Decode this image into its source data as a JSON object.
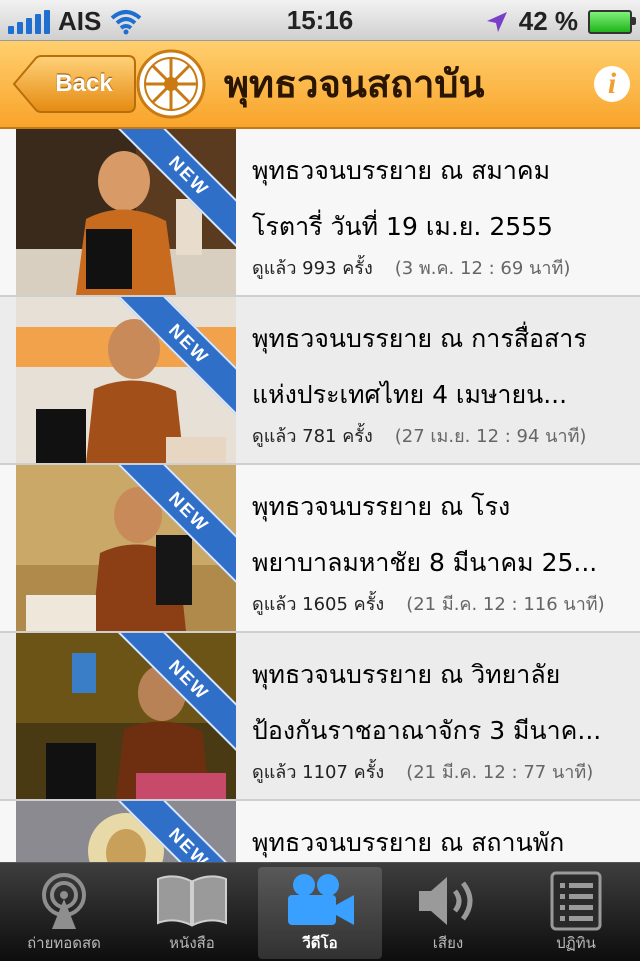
{
  "status": {
    "carrier": "AIS",
    "time": "15:16",
    "battery": "42 %"
  },
  "nav": {
    "back_label": "Back",
    "title": "พุทธวจนสถาบัน"
  },
  "videos": [
    {
      "line1": "พุทธวจนบรรยาย ณ สมาคม",
      "line2": "โรตารี่ วันที่ 19 เม.ย. 2555",
      "views": "ดูแล้ว 993 ครั้ง",
      "info": "(3 พ.ค. 12 : 69 นาที)",
      "badge": "NEW"
    },
    {
      "line1": "พุทธวจนบรรยาย ณ การสื่อสาร",
      "line2": "แห่งประเทศไทย 4 เมษายน...",
      "views": "ดูแล้ว 781 ครั้ง",
      "info": "(27 เม.ย. 12 : 94 นาที)",
      "badge": "NEW"
    },
    {
      "line1": "พุทธวจนบรรยาย ณ โรง",
      "line2": "พยาบาลมหาชัย 8 มีนาคม 25...",
      "views": "ดูแล้ว 1605 ครั้ง",
      "info": "(21 มี.ค. 12 : 116 นาที)",
      "badge": "NEW"
    },
    {
      "line1": "พุทธวจนบรรยาย ณ วิทยาลัย",
      "line2": "ป้องกันราชอาณาจักร 3 มีนาค...",
      "views": "ดูแล้ว 1107 ครั้ง",
      "info": "(21 มี.ค. 12 : 77 นาที)",
      "badge": "NEW"
    },
    {
      "line1": "พุทธวจนบรรยาย ณ สถานพัก",
      "line2": "",
      "views": "",
      "info": "",
      "badge": "NEW"
    }
  ],
  "tabs": [
    {
      "label": "ถ่ายทอดสด",
      "icon": "broadcast-icon"
    },
    {
      "label": "หนังสือ",
      "icon": "book-icon"
    },
    {
      "label": "วีดีโอ",
      "icon": "video-camera-icon"
    },
    {
      "label": "เสียง",
      "icon": "speaker-icon"
    },
    {
      "label": "ปฏิทิน",
      "icon": "calendar-list-icon"
    }
  ],
  "colors": {
    "nav": "#f9a42a",
    "ribbon": "#2f6fc8",
    "tab_active": "#3aa0ff"
  }
}
